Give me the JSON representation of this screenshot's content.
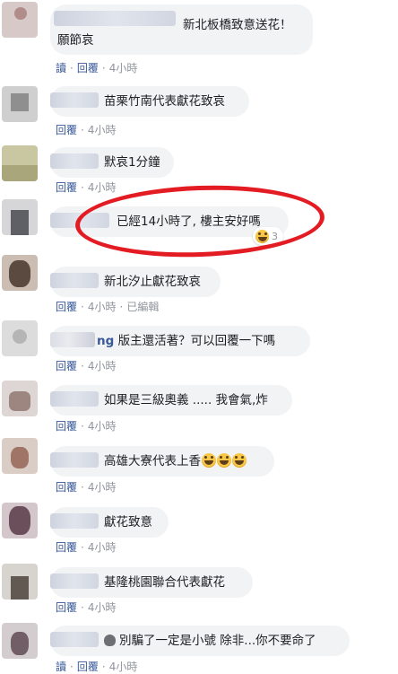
{
  "meta": {
    "reply": "回覆",
    "time": "4小時",
    "edited": "已編輯",
    "read": "讀"
  },
  "comments": [
    {
      "text": "新北板橋致意送花！",
      "text2": "願節哀"
    },
    {
      "text": "苗栗竹南代表獻花致哀"
    },
    {
      "text": "默哀1分鐘"
    },
    {
      "text": "已經14小時了, 樓主安好嗎",
      "reaction_count": "3"
    },
    {
      "text": "新北汐止獻花致哀"
    },
    {
      "name_fragment": "ng",
      "text": "版主還活著？可以回覆一下嗎"
    },
    {
      "text": "如果是三級奧義 ..... 我會氣,炸"
    },
    {
      "text": "高雄大寮代表上香"
    },
    {
      "text": "獻花致意"
    },
    {
      "text": "基隆桃園聯合代表獻花"
    },
    {
      "text": "別騙了一定是小號 除非...你不要命了"
    }
  ],
  "colors": {
    "link": "#385898",
    "meta": "#90949c",
    "bubble": "#f2f3f5",
    "annotation": "#e31c23"
  }
}
